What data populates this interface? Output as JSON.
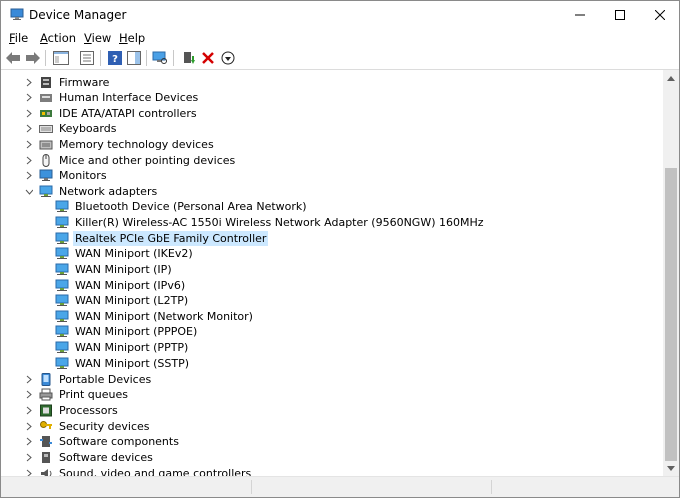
{
  "window": {
    "title": "Device Manager"
  },
  "menu": [
    {
      "label": "File",
      "accel": "F",
      "rest": "ile"
    },
    {
      "label": "Action",
      "accel": "A",
      "rest": "ction"
    },
    {
      "label": "View",
      "accel": "V",
      "rest": "iew"
    },
    {
      "label": "Help",
      "accel": "H",
      "rest": "elp"
    }
  ],
  "tree": {
    "categories_before": [
      {
        "label": "Firmware",
        "icon": "firmware-icon"
      },
      {
        "label": "Human Interface Devices",
        "icon": "hid-icon"
      },
      {
        "label": "IDE ATA/ATAPI controllers",
        "icon": "ide-controller-icon"
      },
      {
        "label": "Keyboards",
        "icon": "keyboard-icon"
      },
      {
        "label": "Memory technology devices",
        "icon": "memory-icon"
      },
      {
        "label": "Mice and other pointing devices",
        "icon": "mouse-icon"
      },
      {
        "label": "Monitors",
        "icon": "monitor-icon"
      }
    ],
    "expanded": {
      "label": "Network adapters",
      "icon": "network-adapter-icon"
    },
    "children": [
      "Bluetooth Device (Personal Area Network)",
      "Killer(R) Wireless-AC 1550i Wireless Network Adapter (9560NGW) 160MHz",
      "Realtek PCIe GbE Family Controller",
      "WAN Miniport (IKEv2)",
      "WAN Miniport (IP)",
      "WAN Miniport (IPv6)",
      "WAN Miniport (L2TP)",
      "WAN Miniport (Network Monitor)",
      "WAN Miniport (PPPOE)",
      "WAN Miniport (PPTP)",
      "WAN Miniport (SSTP)"
    ],
    "selected_child": "Realtek PCIe GbE Family Controller",
    "categories_after": [
      {
        "label": "Portable Devices",
        "icon": "portable-device-icon"
      },
      {
        "label": "Print queues",
        "icon": "printer-icon"
      },
      {
        "label": "Processors",
        "icon": "processor-icon"
      },
      {
        "label": "Security devices",
        "icon": "security-key-icon"
      },
      {
        "label": "Software components",
        "icon": "software-component-icon"
      },
      {
        "label": "Software devices",
        "icon": "software-device-icon"
      },
      {
        "label": "Sound, video and game controllers",
        "icon": "sound-icon"
      }
    ]
  },
  "colors": {
    "selection": "#cce8ff",
    "delete": "#d40000",
    "install": "#2e9e2e"
  }
}
